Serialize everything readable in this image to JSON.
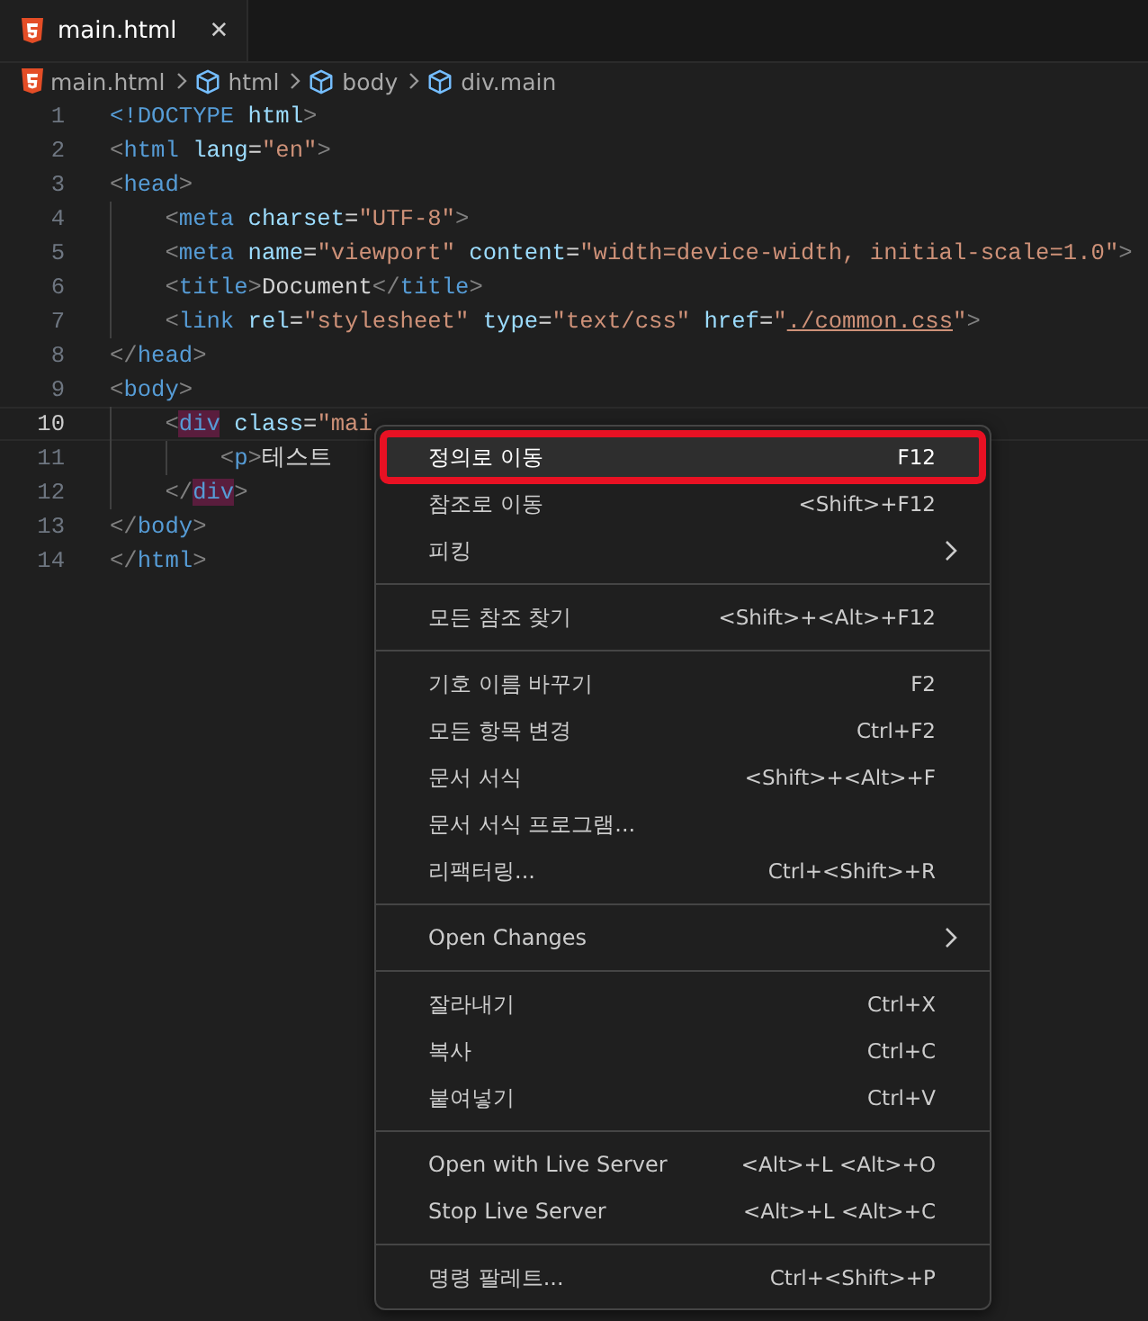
{
  "tabs": [
    {
      "label": "main.html",
      "selected": true,
      "close": "✕"
    }
  ],
  "breadcrumbs": [
    {
      "label": "main.html",
      "kind": "file"
    },
    {
      "label": "html",
      "kind": "element"
    },
    {
      "label": "body",
      "kind": "element"
    },
    {
      "label": "div.main",
      "kind": "element"
    }
  ],
  "code_lines": [
    {
      "number": "1",
      "current": false,
      "tokens": [
        {
          "t": "<!DOCTYPE ",
          "kind": "tag"
        },
        {
          "t": "html",
          "kind": "attr"
        },
        {
          "t": ">",
          "kind": "punct"
        }
      ]
    },
    {
      "number": "2",
      "current": false,
      "tokens": [
        {
          "t": "<",
          "kind": "punct"
        },
        {
          "t": "html",
          "kind": "tag"
        },
        {
          "t": " lang",
          "kind": "attr"
        },
        {
          "t": "=",
          "kind": "text"
        },
        {
          "t": "\"en\"",
          "kind": "str"
        },
        {
          "t": ">",
          "kind": "punct"
        }
      ]
    },
    {
      "number": "3",
      "current": false,
      "tokens": [
        {
          "t": "<",
          "kind": "punct"
        },
        {
          "t": "head",
          "kind": "tag"
        },
        {
          "t": ">",
          "kind": "punct"
        }
      ],
      "children": [
        {
          "number": "4",
          "current": false,
          "tokens": [
            {
              "t": "<",
              "kind": "punct"
            },
            {
              "t": "meta",
              "kind": "tag"
            },
            {
              "t": " charset",
              "kind": "attr"
            },
            {
              "t": "=",
              "kind": "text"
            },
            {
              "t": "\"UTF-8\"",
              "kind": "str"
            },
            {
              "t": ">",
              "kind": "punct"
            }
          ]
        },
        {
          "number": "5",
          "current": false,
          "tokens": [
            {
              "t": "<",
              "kind": "punct"
            },
            {
              "t": "meta",
              "kind": "tag"
            },
            {
              "t": " name",
              "kind": "attr"
            },
            {
              "t": "=",
              "kind": "text"
            },
            {
              "t": "\"viewport\"",
              "kind": "str"
            },
            {
              "t": " content",
              "kind": "attr"
            },
            {
              "t": "=",
              "kind": "text"
            },
            {
              "t": "\"width=device-width, initial-scale=1.0\"",
              "kind": "str"
            },
            {
              "t": ">",
              "kind": "punct"
            }
          ]
        },
        {
          "number": "6",
          "current": false,
          "tokens": [
            {
              "t": "<",
              "kind": "punct"
            },
            {
              "t": "title",
              "kind": "tag"
            },
            {
              "t": ">",
              "kind": "punct"
            },
            {
              "t": "Document",
              "kind": "text"
            },
            {
              "t": "</",
              "kind": "punct"
            },
            {
              "t": "title",
              "kind": "tag"
            },
            {
              "t": ">",
              "kind": "punct"
            }
          ]
        },
        {
          "number": "7",
          "current": false,
          "tokens": [
            {
              "t": "<",
              "kind": "punct"
            },
            {
              "t": "link",
              "kind": "tag"
            },
            {
              "t": " rel",
              "kind": "attr"
            },
            {
              "t": "=",
              "kind": "text"
            },
            {
              "t": "\"stylesheet\"",
              "kind": "str"
            },
            {
              "t": " type",
              "kind": "attr"
            },
            {
              "t": "=",
              "kind": "text"
            },
            {
              "t": "\"text/css\"",
              "kind": "str"
            },
            {
              "t": " href",
              "kind": "attr"
            },
            {
              "t": "=",
              "kind": "text"
            },
            {
              "t": "\"",
              "kind": "str"
            },
            {
              "t": "./common.css",
              "kind": "link"
            },
            {
              "t": "\"",
              "kind": "str"
            },
            {
              "t": ">",
              "kind": "punct"
            }
          ]
        }
      ]
    },
    {
      "number": "8",
      "current": false,
      "tokens": [
        {
          "t": "</",
          "kind": "punct"
        },
        {
          "t": "head",
          "kind": "tag"
        },
        {
          "t": ">",
          "kind": "punct"
        }
      ]
    },
    {
      "number": "9",
      "current": false,
      "tokens": [
        {
          "t": "<",
          "kind": "punct"
        },
        {
          "t": "body",
          "kind": "tag"
        },
        {
          "t": ">",
          "kind": "punct"
        }
      ],
      "children": [
        {
          "number": "10",
          "current": true,
          "tokens": [
            {
              "t": "<",
              "kind": "punct"
            },
            {
              "t": "div",
              "kind": "match"
            },
            {
              "t": " class",
              "kind": "attr"
            },
            {
              "t": "=",
              "kind": "text"
            },
            {
              "t": "\"mai",
              "kind": "str"
            }
          ],
          "children": [
            {
              "number": "11",
              "current": false,
              "tokens": [
                {
                  "t": "<",
                  "kind": "punct"
                },
                {
                  "t": "p",
                  "kind": "tag"
                },
                {
                  "t": ">",
                  "kind": "punct"
                },
                {
                  "t": "테스트",
                  "kind": "text"
                }
              ]
            }
          ]
        },
        {
          "number": "12",
          "current": false,
          "tokens": [
            {
              "t": "</",
              "kind": "punct"
            },
            {
              "t": "div",
              "kind": "match"
            },
            {
              "t": ">",
              "kind": "punct"
            }
          ]
        }
      ]
    },
    {
      "number": "13",
      "current": false,
      "tokens": [
        {
          "t": "</",
          "kind": "punct"
        },
        {
          "t": "body",
          "kind": "tag"
        },
        {
          "t": ">",
          "kind": "punct"
        }
      ]
    },
    {
      "number": "14",
      "current": false,
      "tokens": [
        {
          "t": "</",
          "kind": "punct"
        },
        {
          "t": "html",
          "kind": "tag"
        },
        {
          "t": ">",
          "kind": "punct"
        }
      ]
    }
  ],
  "context_menu": [
    {
      "kind": "item",
      "label": "정의로 이동",
      "shortcut": "F12",
      "selected": true
    },
    {
      "kind": "item",
      "label": "참조로 이동",
      "shortcut": "<Shift>+F12",
      "selected": false
    },
    {
      "kind": "submenu",
      "label": "피킹",
      "selected": false
    },
    {
      "kind": "separator"
    },
    {
      "kind": "item",
      "label": "모든 참조 찾기",
      "shortcut": "<Shift>+<Alt>+F12",
      "selected": false
    },
    {
      "kind": "separator"
    },
    {
      "kind": "item",
      "label": "기호 이름 바꾸기",
      "shortcut": "F2",
      "selected": false
    },
    {
      "kind": "item",
      "label": "모든 항목 변경",
      "shortcut": "Ctrl+F2",
      "selected": false
    },
    {
      "kind": "item",
      "label": "문서 서식",
      "shortcut": "<Shift>+<Alt>+F",
      "selected": false
    },
    {
      "kind": "item",
      "label": "문서 서식 프로그램...",
      "selected": false
    },
    {
      "kind": "item",
      "label": "리팩터링...",
      "shortcut": "Ctrl+<Shift>+R",
      "selected": false
    },
    {
      "kind": "separator"
    },
    {
      "kind": "submenu",
      "label": "Open Changes",
      "selected": false
    },
    {
      "kind": "separator"
    },
    {
      "kind": "item",
      "label": "잘라내기",
      "shortcut": "Ctrl+X",
      "selected": false
    },
    {
      "kind": "item",
      "label": "복사",
      "shortcut": "Ctrl+C",
      "selected": false
    },
    {
      "kind": "item",
      "label": "붙여넣기",
      "shortcut": "Ctrl+V",
      "selected": false
    },
    {
      "kind": "separator"
    },
    {
      "kind": "item",
      "label": "Open with Live Server",
      "shortcut": "<Alt>+L <Alt>+O",
      "selected": false
    },
    {
      "kind": "item",
      "label": "Stop Live Server",
      "shortcut": "<Alt>+L <Alt>+C",
      "selected": false
    },
    {
      "kind": "separator"
    },
    {
      "kind": "item",
      "label": "명령 팔레트...",
      "shortcut": "Ctrl+<Shift>+P",
      "selected": false
    }
  ]
}
